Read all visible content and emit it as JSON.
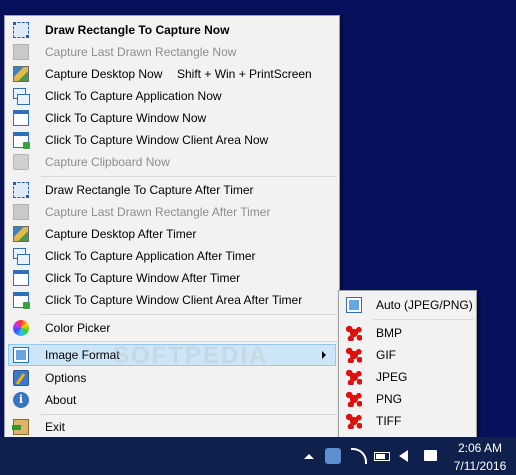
{
  "menu": {
    "items": [
      {
        "label": "Draw Rectangle To Capture Now",
        "icon": "draw-rectangle-icon"
      },
      {
        "label": "Capture Last Drawn Rectangle Now",
        "icon": "last-rectangle-icon"
      },
      {
        "label": "Capture Desktop Now",
        "shortcut": "Shift + Win + PrintScreen",
        "icon": "desktop-icon"
      },
      {
        "label": "Click To Capture Application Now",
        "icon": "application-icon"
      },
      {
        "label": "Click To Capture Window Now",
        "icon": "window-icon"
      },
      {
        "label": "Click To Capture Window Client Area Now",
        "icon": "window-client-area-icon"
      },
      {
        "label": "Capture Clipboard Now",
        "icon": "clipboard-icon"
      },
      {
        "label": "Draw Rectangle To Capture After Timer",
        "icon": "draw-rectangle-icon"
      },
      {
        "label": "Capture Last Drawn Rectangle After Timer",
        "icon": "last-rectangle-icon"
      },
      {
        "label": "Capture Desktop After Timer",
        "icon": "desktop-icon"
      },
      {
        "label": "Click To Capture Application After Timer",
        "icon": "application-icon"
      },
      {
        "label": "Click To Capture Window After Timer",
        "icon": "window-icon"
      },
      {
        "label": "Click To Capture Window Client Area After Timer",
        "icon": "window-client-area-icon"
      },
      {
        "label": "Color Picker",
        "icon": "color-picker-icon"
      },
      {
        "label": "Image Format",
        "icon": "image-format-icon"
      },
      {
        "label": "Options",
        "icon": "options-icon"
      },
      {
        "label": "About",
        "icon": "info-icon"
      },
      {
        "label": "Exit",
        "icon": "exit-icon"
      }
    ]
  },
  "submenu": {
    "items": [
      {
        "label": "Auto (JPEG/PNG)",
        "icon": "auto-format-icon"
      },
      {
        "label": "BMP",
        "icon": "splat-icon"
      },
      {
        "label": "GIF",
        "icon": "splat-icon"
      },
      {
        "label": "JPEG",
        "icon": "splat-icon"
      },
      {
        "label": "PNG",
        "icon": "splat-icon"
      },
      {
        "label": "TIFF",
        "icon": "splat-icon"
      }
    ]
  },
  "watermark": "SOFTPEDIA",
  "taskbar": {
    "time": "2:06 AM",
    "date": "7/11/2016"
  },
  "colors": {
    "desktop": "#06105c",
    "menu_background": "#f2f2f2",
    "highlight": "#cde6f7",
    "taskbar": "#10204d"
  }
}
